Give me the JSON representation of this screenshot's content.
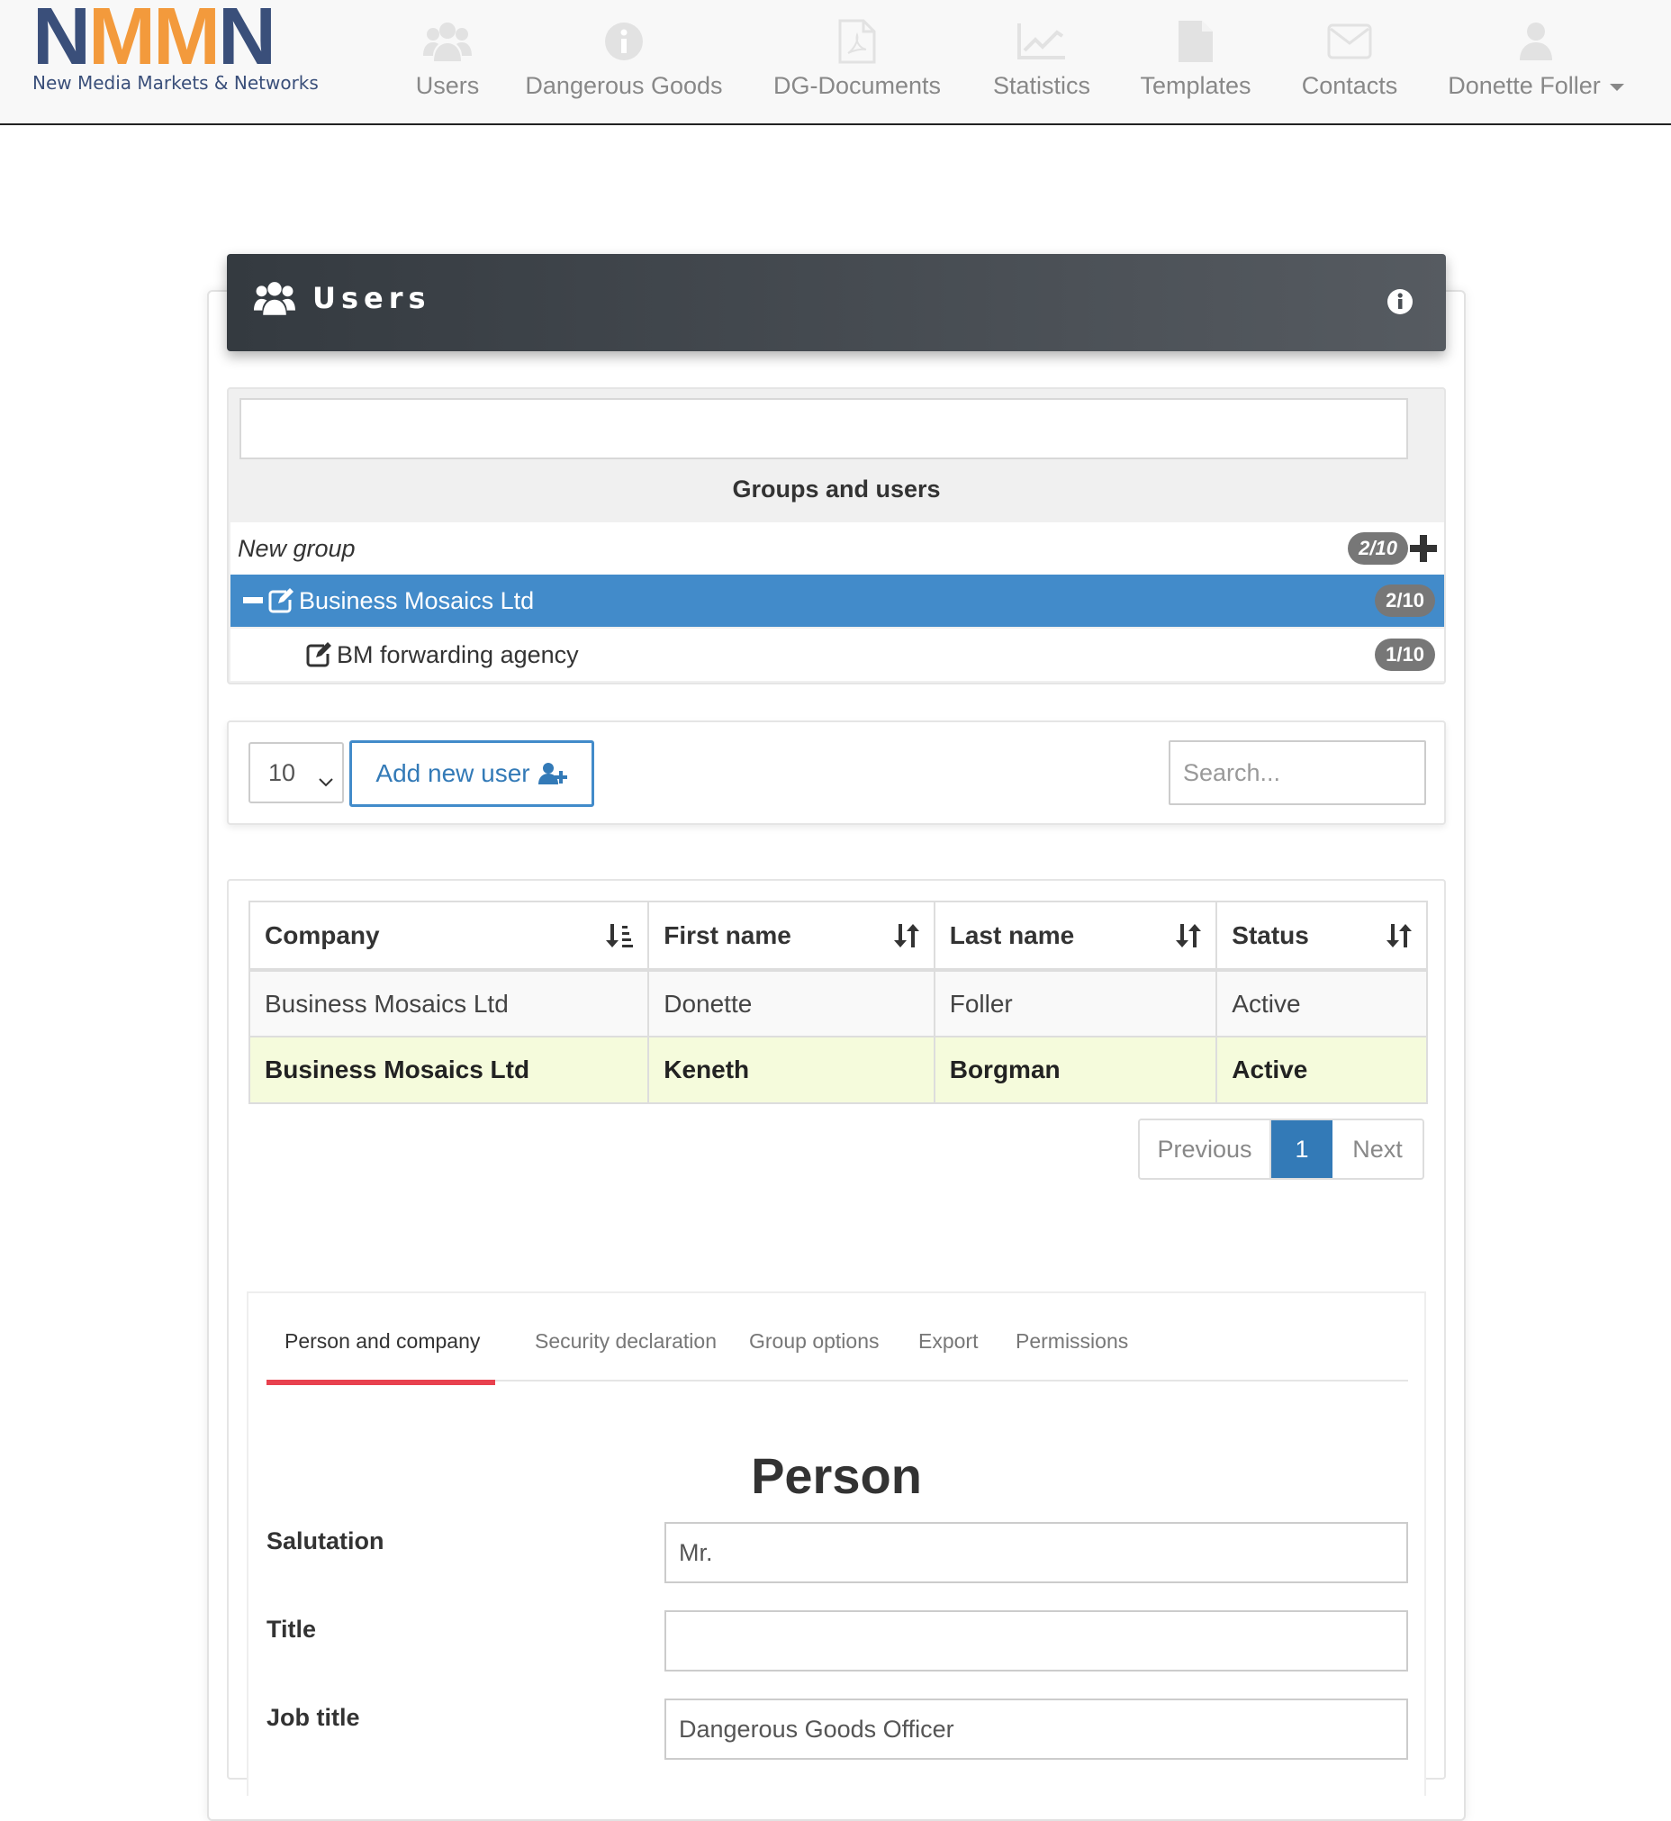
{
  "logo": {
    "letters": [
      "N",
      "M",
      "M",
      "N"
    ],
    "subtitle": "New Media Markets & Networks",
    "colors": {
      "blue": "#3a4f7a",
      "orange": "#f39a3c"
    }
  },
  "nav": {
    "items": [
      {
        "label": "Users",
        "icon": "users-icon"
      },
      {
        "label": "Dangerous Goods",
        "icon": "info-circle-icon"
      },
      {
        "label": "DG-Documents",
        "icon": "pdf-file-icon"
      },
      {
        "label": "Statistics",
        "icon": "line-chart-icon"
      },
      {
        "label": "Templates",
        "icon": "file-icon"
      },
      {
        "label": "Contacts",
        "icon": "envelope-icon"
      },
      {
        "label": "Donette Foller",
        "icon": "user-icon"
      }
    ]
  },
  "header": {
    "title": "Users",
    "icon": "users-icon",
    "info_icon": "info-circle-icon"
  },
  "groups": {
    "filter_value": "",
    "title": "Groups and users",
    "new_group": {
      "label": "New group",
      "badge": "2/10",
      "icon": "plus-icon"
    },
    "selected": {
      "label": "Business Mosaics Ltd",
      "badge": "2/10"
    },
    "children": [
      {
        "label": "BM forwarding agency",
        "badge": "1/10"
      }
    ],
    "accent": "#428bca"
  },
  "toolbar": {
    "page_size": "10",
    "add_user_label": "Add new user",
    "search_placeholder": "Search..."
  },
  "table": {
    "columns": [
      "Company",
      "First name",
      "Last name",
      "Status"
    ],
    "rows": [
      [
        "Business Mosaics Ltd",
        "Donette",
        "Foller",
        "Active"
      ],
      [
        "Business Mosaics Ltd",
        "Keneth",
        "Borgman",
        "Active"
      ]
    ]
  },
  "pager": {
    "previous": "Previous",
    "current": "1",
    "next": "Next"
  },
  "detail": {
    "tabs": [
      "Person and company",
      "Security declaration",
      "Group options",
      "Export",
      "Permissions"
    ],
    "active_tab": "Person and company",
    "section_title": "Person",
    "fields": [
      {
        "label": "Salutation",
        "value": "Mr."
      },
      {
        "label": "Title",
        "value": ""
      },
      {
        "label": "Job title",
        "value": "Dangerous Goods Officer"
      }
    ],
    "tab_accent": "#e8414e"
  }
}
